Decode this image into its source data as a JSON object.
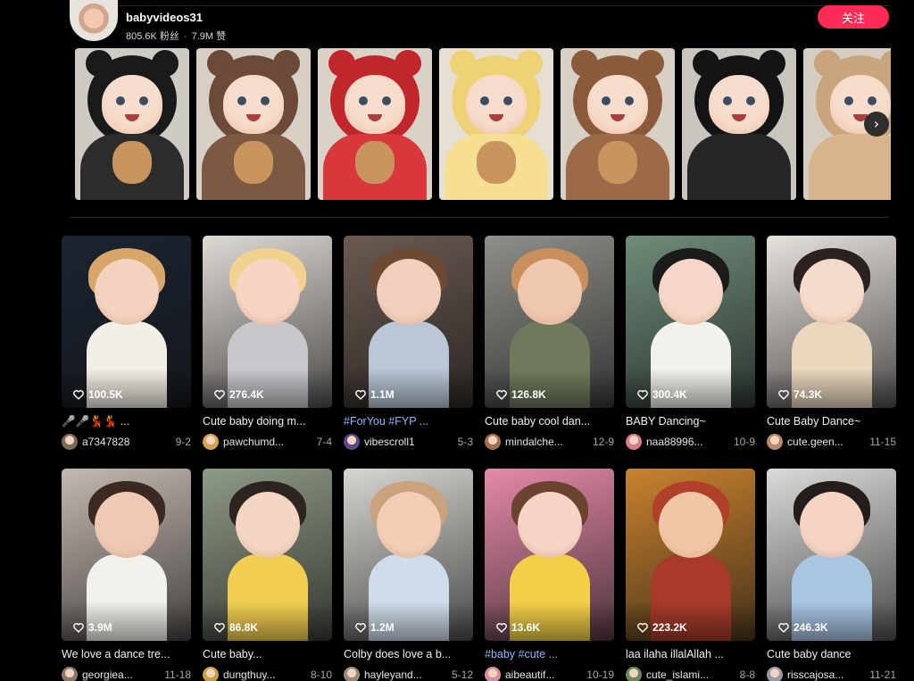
{
  "profile": {
    "username": "babyvideos31",
    "followers": "805.6K 粉丝",
    "likes": "7.9M 赞",
    "follow_label": "关注"
  },
  "carousel": {
    "next_icon": "chevron-right-icon",
    "items": [
      {
        "outfit": "black bear costume",
        "color": "#1a1a1a",
        "accent": "#2c2c2c",
        "bg": "#cfcac3",
        "toy": true
      },
      {
        "outfit": "brown bear costume",
        "color": "#6b4a37",
        "accent": "#7d5842",
        "bg": "#d7cfc6",
        "toy": true
      },
      {
        "outfit": "red bear costume",
        "color": "#c0262c",
        "accent": "#d8383b",
        "bg": "#d9d2c9",
        "toy": true
      },
      {
        "outfit": "yellow bear costume",
        "color": "#f0d276",
        "accent": "#f6df92",
        "bg": "#e6dfd2",
        "toy": true
      },
      {
        "outfit": "brown bear costume",
        "color": "#8a5a3a",
        "accent": "#9c6a46",
        "bg": "#d8cfc5",
        "toy": true
      },
      {
        "outfit": "black cat costume",
        "color": "#141414",
        "accent": "#262626",
        "bg": "#c9c4be",
        "toy": false
      },
      {
        "outfit": "tan bear costume",
        "color": "#caa47d",
        "accent": "#d8b38c",
        "bg": "#d6cdc2",
        "toy": false
      }
    ]
  },
  "videos": [
    {
      "likes": "100.5K",
      "caption": "🎤🎤💃💃 ...",
      "author": "a7347828",
      "date": "9-2",
      "bg": "#1b2431",
      "skin": "#f3d3bf",
      "hair": "#d8a56a",
      "outfit": "#f4efe6",
      "avatar": "#7a6a5a"
    },
    {
      "likes": "276.4K",
      "caption": "Cute baby doing m...",
      "author": "pawchumd...",
      "date": "7-4",
      "bg": "#dfd9d4",
      "skin": "#f6d5c4",
      "hair": "#f1d28f",
      "outfit": "#c8c8cc",
      "avatar": "#d6a24a"
    },
    {
      "likes": "1.1M",
      "caption": "#ForYou #FYP ...",
      "tag": true,
      "author": "vibescroll1",
      "date": "5-3",
      "bg": "#6a5a52",
      "skin": "#f0d0bd",
      "hair": "#6b4a33",
      "outfit": "#b9c7d6",
      "avatar": "#5b4a8a"
    },
    {
      "likes": "126.8K",
      "caption": "Cute baby cool dan...",
      "author": "mindalche...",
      "date": "12-9",
      "bg": "#8e8f8a",
      "skin": "#efc7ad",
      "hair": "#c98f5d",
      "outfit": "#6f7a5c",
      "avatar": "#a07050"
    },
    {
      "likes": "300.4K",
      "caption": "BABY Dancing~",
      "author": "naa88996...",
      "date": "10-9",
      "bg": "#6f8c7a",
      "skin": "#f4d7c6",
      "hair": "#1d1a1a",
      "outfit": "#f3f1ec",
      "avatar": "#d87a8a"
    },
    {
      "likes": "74.3K",
      "caption": "Cute Baby Dance~",
      "author": "cute.geen...",
      "date": "11-15",
      "bg": "#e7e1dc",
      "skin": "#f6dacb",
      "hair": "#2b2220",
      "outfit": "#ead8be",
      "avatar": "#b88a6a"
    },
    {
      "likes": "3.9M",
      "caption": "We love a dance tre...",
      "author": "georgiea...",
      "date": "11-18",
      "bg": "#c4b9b2",
      "skin": "#efc9b4",
      "hair": "#3a2a22",
      "outfit": "#f2f0ea",
      "avatar": "#8a7a6a"
    },
    {
      "likes": "86.8K",
      "caption": "Cute baby...",
      "author": "dungthuy...",
      "date": "8-10",
      "bg": "#8f9a86",
      "skin": "#f5d6c3",
      "hair": "#2c2420",
      "outfit": "#f2cf52",
      "avatar": "#c7a23a"
    },
    {
      "likes": "1.2M",
      "caption": "Colby does love a b...",
      "author": "hayleyand...",
      "date": "5-12",
      "bg": "#d8d6d2",
      "skin": "#f3cdb6",
      "hair": "#caa27c",
      "outfit": "#cfdcea",
      "avatar": "#9a8a7a"
    },
    {
      "likes": "13.6K",
      "caption": "#baby #cute ...",
      "tag": true,
      "author": "aibeautif...",
      "date": "10-19",
      "bg": "#e58aa8",
      "skin": "#f6d5c6",
      "hair": "#6b4330",
      "outfit": "#f3d04a",
      "avatar": "#d88aa8"
    },
    {
      "likes": "223.2K",
      "caption": "laa ilaha illalAllah ...",
      "author": "cute_islami...",
      "date": "8-8",
      "bg": "#c9822f",
      "skin": "#f0c7a6",
      "hair": "#b0402a",
      "outfit": "#a83a2a",
      "avatar": "#6a8a5a"
    },
    {
      "likes": "246.3K",
      "caption": "Cute baby dance",
      "author": "risscajosa...",
      "date": "11-21",
      "bg": "#d9dcd8",
      "skin": "#f6d4c4",
      "hair": "#241d1b",
      "outfit": "#a9c6e4",
      "avatar": "#9a9aaa"
    }
  ]
}
